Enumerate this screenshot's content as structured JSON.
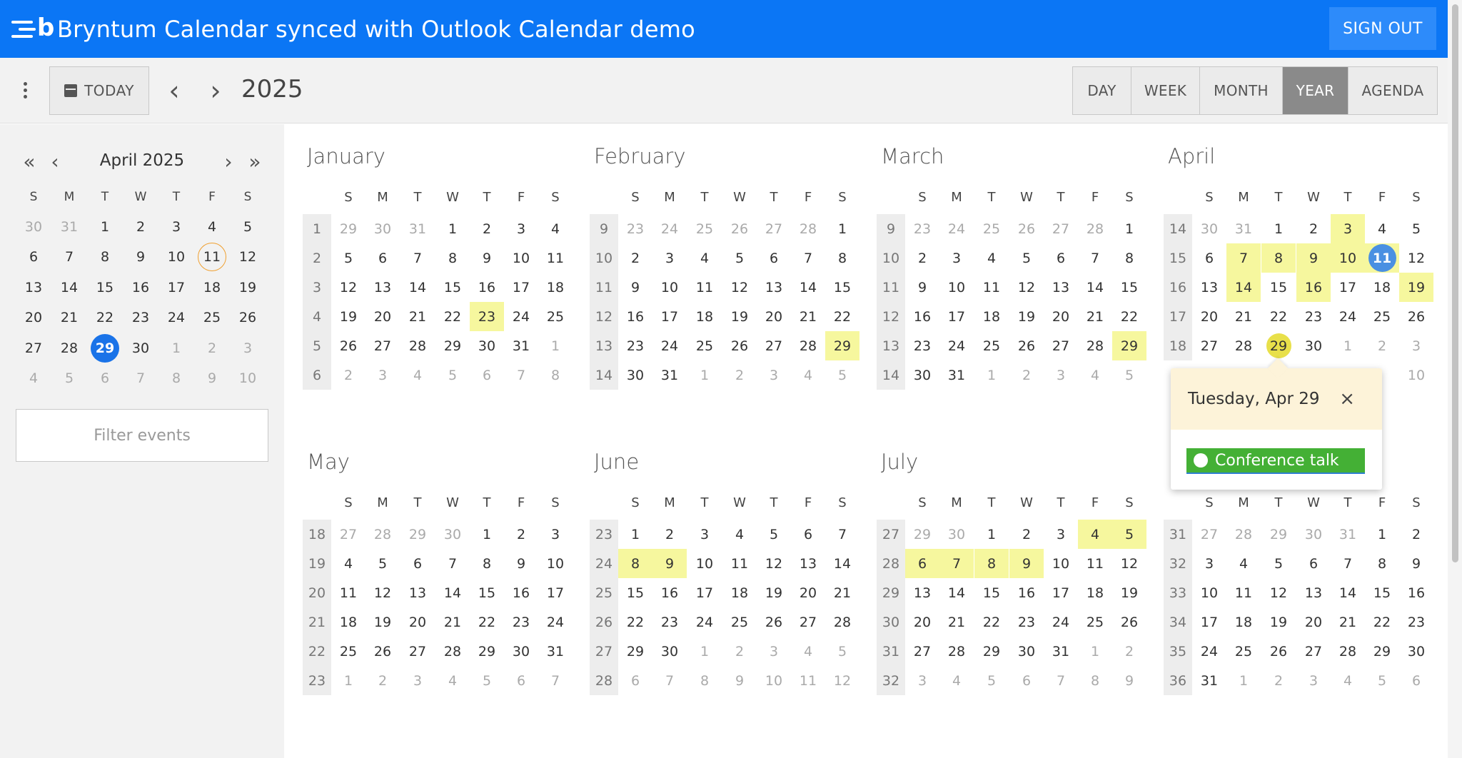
{
  "header": {
    "title": "Bryntum Calendar synced with Outlook Calendar demo",
    "logo_letter": "b",
    "signout_label": "SIGN OUT"
  },
  "toolbar": {
    "today_label": "TODAY",
    "prev_icon": "‹",
    "next_icon": "›",
    "period": "2025",
    "views": [
      "DAY",
      "WEEK",
      "MONTH",
      "YEAR",
      "AGENDA"
    ],
    "active_view": "YEAR"
  },
  "sidebar": {
    "mini_title": "April 2025",
    "nav": {
      "first": "«",
      "prev": "‹",
      "next": "›",
      "last": "»"
    },
    "dow": [
      "S",
      "M",
      "T",
      "W",
      "T",
      "F",
      "S"
    ],
    "weeks": [
      [
        "30",
        "31",
        "1",
        "2",
        "3",
        "4",
        "5"
      ],
      [
        "6",
        "7",
        "8",
        "9",
        "10",
        "11",
        "12"
      ],
      [
        "13",
        "14",
        "15",
        "16",
        "17",
        "18",
        "19"
      ],
      [
        "20",
        "21",
        "22",
        "23",
        "24",
        "25",
        "26"
      ],
      [
        "27",
        "28",
        "29",
        "30",
        "1",
        "2",
        "3"
      ],
      [
        "4",
        "5",
        "6",
        "7",
        "8",
        "9",
        "10"
      ]
    ],
    "other_cells": [
      "0-0",
      "0-1",
      "4-4",
      "4-5",
      "4-6",
      "5-0",
      "5-1",
      "5-2",
      "5-3",
      "5-4",
      "5-5",
      "5-6"
    ],
    "today_cell": "1-5",
    "selected_cell": "4-2",
    "filter_placeholder": "Filter events"
  },
  "year": {
    "dow": [
      "S",
      "M",
      "T",
      "W",
      "T",
      "F",
      "S"
    ],
    "months": [
      {
        "name": "January",
        "weeknums": [
          "1",
          "2",
          "3",
          "4",
          "5",
          "6"
        ],
        "weeks": [
          [
            "29",
            "30",
            "31",
            "1",
            "2",
            "3",
            "4"
          ],
          [
            "5",
            "6",
            "7",
            "8",
            "9",
            "10",
            "11"
          ],
          [
            "12",
            "13",
            "14",
            "15",
            "16",
            "17",
            "18"
          ],
          [
            "19",
            "20",
            "21",
            "22",
            "23",
            "24",
            "25"
          ],
          [
            "26",
            "27",
            "28",
            "29",
            "30",
            "31",
            "1"
          ],
          [
            "2",
            "3",
            "4",
            "5",
            "6",
            "7",
            "8"
          ]
        ],
        "other": [
          "0-0",
          "0-1",
          "0-2",
          "4-6",
          "5-0",
          "5-1",
          "5-2",
          "5-3",
          "5-4",
          "5-5",
          "5-6"
        ],
        "events": [
          "3-4"
        ]
      },
      {
        "name": "February",
        "weeknums": [
          "9",
          "10",
          "11",
          "12",
          "13",
          "14"
        ],
        "weeks": [
          [
            "23",
            "24",
            "25",
            "26",
            "27",
            "28",
            "1"
          ],
          [
            "2",
            "3",
            "4",
            "5",
            "6",
            "7",
            "8"
          ],
          [
            "9",
            "10",
            "11",
            "12",
            "13",
            "14",
            "15"
          ],
          [
            "16",
            "17",
            "18",
            "19",
            "20",
            "21",
            "22"
          ],
          [
            "23",
            "24",
            "25",
            "26",
            "27",
            "28",
            "29"
          ],
          [
            "30",
            "31",
            "1",
            "2",
            "3",
            "4",
            "5"
          ]
        ],
        "other": [
          "0-0",
          "0-1",
          "0-2",
          "0-3",
          "0-4",
          "0-5",
          "5-2",
          "5-3",
          "5-4",
          "5-5",
          "5-6"
        ],
        "events": [
          "4-6"
        ]
      },
      {
        "name": "March",
        "weeknums": [
          "9",
          "10",
          "11",
          "12",
          "13",
          "14"
        ],
        "weeks": [
          [
            "23",
            "24",
            "25",
            "26",
            "27",
            "28",
            "1"
          ],
          [
            "2",
            "3",
            "4",
            "5",
            "6",
            "7",
            "8"
          ],
          [
            "9",
            "10",
            "11",
            "12",
            "13",
            "14",
            "15"
          ],
          [
            "16",
            "17",
            "18",
            "19",
            "20",
            "21",
            "22"
          ],
          [
            "23",
            "24",
            "25",
            "26",
            "27",
            "28",
            "29"
          ],
          [
            "30",
            "31",
            "1",
            "2",
            "3",
            "4",
            "5"
          ]
        ],
        "other": [
          "0-0",
          "0-1",
          "0-2",
          "0-3",
          "0-4",
          "0-5",
          "5-2",
          "5-3",
          "5-4",
          "5-5",
          "5-6"
        ],
        "events": [
          "4-6"
        ]
      },
      {
        "name": "April",
        "weeknums": [
          "14",
          "15",
          "16",
          "17",
          "18",
          ""
        ],
        "weeks": [
          [
            "30",
            "31",
            "1",
            "2",
            "3",
            "4",
            "5"
          ],
          [
            "6",
            "7",
            "8",
            "9",
            "10",
            "11",
            "12"
          ],
          [
            "13",
            "14",
            "15",
            "16",
            "17",
            "18",
            "19"
          ],
          [
            "20",
            "21",
            "22",
            "23",
            "24",
            "25",
            "26"
          ],
          [
            "27",
            "28",
            "29",
            "30",
            "1",
            "2",
            "3"
          ],
          [
            "",
            "",
            "",
            "",
            "",
            "",
            "10"
          ]
        ],
        "other": [
          "0-0",
          "0-1",
          "4-4",
          "4-5",
          "4-6",
          "5-6"
        ],
        "events": [
          "0-4",
          "1-1",
          "1-2",
          "1-3",
          "1-4",
          "1-5",
          "2-1",
          "2-3",
          "2-6"
        ],
        "circle_today": "1-5",
        "circle_selected": "4-2"
      },
      {
        "name": "May",
        "weeknums": [
          "18",
          "19",
          "20",
          "21",
          "22",
          "23"
        ],
        "weeks": [
          [
            "27",
            "28",
            "29",
            "30",
            "1",
            "2",
            "3"
          ],
          [
            "4",
            "5",
            "6",
            "7",
            "8",
            "9",
            "10"
          ],
          [
            "11",
            "12",
            "13",
            "14",
            "15",
            "16",
            "17"
          ],
          [
            "18",
            "19",
            "20",
            "21",
            "22",
            "23",
            "24"
          ],
          [
            "25",
            "26",
            "27",
            "28",
            "29",
            "30",
            "31"
          ],
          [
            "1",
            "2",
            "3",
            "4",
            "5",
            "6",
            "7"
          ]
        ],
        "other": [
          "0-0",
          "0-1",
          "0-2",
          "0-3",
          "5-0",
          "5-1",
          "5-2",
          "5-3",
          "5-4",
          "5-5",
          "5-6"
        ],
        "events": []
      },
      {
        "name": "June",
        "weeknums": [
          "23",
          "24",
          "25",
          "26",
          "27",
          "28"
        ],
        "weeks": [
          [
            "1",
            "2",
            "3",
            "4",
            "5",
            "6",
            "7"
          ],
          [
            "8",
            "9",
            "10",
            "11",
            "12",
            "13",
            "14"
          ],
          [
            "15",
            "16",
            "17",
            "18",
            "19",
            "20",
            "21"
          ],
          [
            "22",
            "23",
            "24",
            "25",
            "26",
            "27",
            "28"
          ],
          [
            "29",
            "30",
            "1",
            "2",
            "3",
            "4",
            "5"
          ],
          [
            "6",
            "7",
            "8",
            "9",
            "10",
            "11",
            "12"
          ]
        ],
        "other": [
          "4-2",
          "4-3",
          "4-4",
          "4-5",
          "4-6",
          "5-0",
          "5-1",
          "5-2",
          "5-3",
          "5-4",
          "5-5",
          "5-6"
        ],
        "events": [
          "1-0",
          "1-1"
        ]
      },
      {
        "name": "July",
        "weeknums": [
          "27",
          "28",
          "29",
          "30",
          "31",
          "32"
        ],
        "weeks": [
          [
            "29",
            "30",
            "1",
            "2",
            "3",
            "4",
            "5"
          ],
          [
            "6",
            "7",
            "8",
            "9",
            "10",
            "11",
            "12"
          ],
          [
            "13",
            "14",
            "15",
            "16",
            "17",
            "18",
            "19"
          ],
          [
            "20",
            "21",
            "22",
            "23",
            "24",
            "25",
            "26"
          ],
          [
            "27",
            "28",
            "29",
            "30",
            "31",
            "1",
            "2"
          ],
          [
            "3",
            "4",
            "5",
            "6",
            "7",
            "8",
            "9"
          ]
        ],
        "other": [
          "0-0",
          "0-1",
          "4-5",
          "4-6",
          "5-0",
          "5-1",
          "5-2",
          "5-3",
          "5-4",
          "5-5",
          "5-6"
        ],
        "events": [
          "0-5",
          "0-6",
          "1-0",
          "1-1",
          "1-2",
          "1-3"
        ]
      },
      {
        "name": "",
        "weeknums": [
          "31",
          "32",
          "33",
          "34",
          "35",
          "36"
        ],
        "weeks": [
          [
            "27",
            "28",
            "29",
            "30",
            "31",
            "1",
            "2"
          ],
          [
            "3",
            "4",
            "5",
            "6",
            "7",
            "8",
            "9"
          ],
          [
            "10",
            "11",
            "12",
            "13",
            "14",
            "15",
            "16"
          ],
          [
            "17",
            "18",
            "19",
            "20",
            "21",
            "22",
            "23"
          ],
          [
            "24",
            "25",
            "26",
            "27",
            "28",
            "29",
            "30"
          ],
          [
            "31",
            "1",
            "2",
            "3",
            "4",
            "5",
            "6"
          ]
        ],
        "other": [
          "0-0",
          "0-1",
          "0-2",
          "0-3",
          "0-4",
          "5-1",
          "5-2",
          "5-3",
          "5-4",
          "5-5",
          "5-6"
        ],
        "events": []
      }
    ]
  },
  "popup": {
    "title": "Tuesday, Apr 29",
    "close_icon": "×",
    "event_name": "Conference talk",
    "event_color": "#44b035"
  },
  "colors": {
    "brand": "#0b76f5",
    "event_highlight": "#f6f79e",
    "selected": "#1a73e8"
  }
}
